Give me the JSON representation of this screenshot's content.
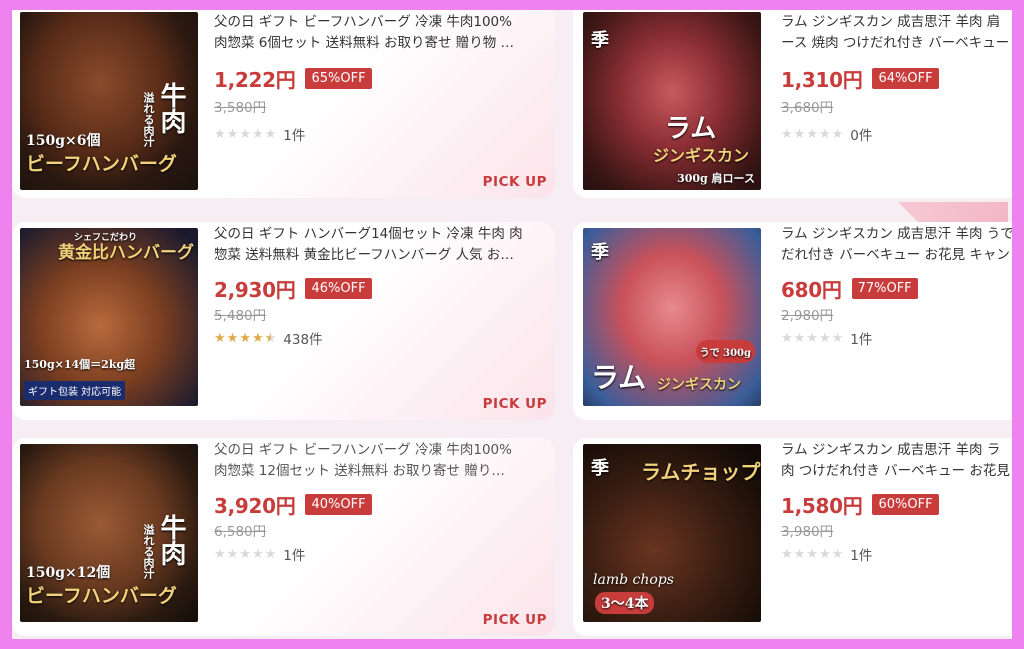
{
  "products": [
    {
      "id": "p1",
      "title_line1": "父の日 ギフト ビーフハンバーグ 冷凍 牛肉100%",
      "title_line2": "肉惣菜 6個セット 送料無料 お取り寄せ 贈り物 …",
      "price": "1,222円",
      "discount": "65%OFF",
      "original_price": "3,580円",
      "rating": 0,
      "review_count": "1件",
      "pickup": "PICK UP",
      "image_label_main": "ビーフハンバーグ",
      "image_label_count": "150g×6個",
      "image_label_side": "溢れる肉汁",
      "image_label_beef": "牛肉"
    },
    {
      "id": "p2",
      "title_line1": "ラム ジンギスカン 成吉思汗 羊肉 肩",
      "title_line2": "ース 焼肉 つけだれ付き バーベキュー",
      "price": "1,310円",
      "discount": "64%OFF",
      "original_price": "3,680円",
      "rating": 0,
      "review_count": "0件",
      "image_label_main": "ラム",
      "image_label_sub": "ジンギスカン",
      "image_label_weight": "300g 肩ロース",
      "image_label_season": "季"
    },
    {
      "id": "p3",
      "title_line1": "父の日 ギフト ハンバーグ14個セット 冷凍 牛肉 肉",
      "title_line2": "惣菜 送料無料 黄金比ビーフハンバーグ 人気 お…",
      "price": "2,930円",
      "discount": "46%OFF",
      "original_price": "5,480円",
      "rating": 4.5,
      "review_count": "438件",
      "pickup": "PICK UP",
      "image_label_main": "黄金比ハンバーグ",
      "image_label_top": "シェフこだわり",
      "image_label_count": "150g×14個＝2kg超",
      "image_label_gift": "ギフト包装 対応可能"
    },
    {
      "id": "p4",
      "title_line1": "ラム ジンギスカン 成吉思汗 羊肉 うで",
      "title_line2": "だれ付き バーベキュー お花見 キャン",
      "price": "680円",
      "discount": "77%OFF",
      "original_price": "2,980円",
      "rating": 0,
      "review_count": "1件",
      "image_label_main": "ラム",
      "image_label_sub": "ジンギスカン",
      "image_label_weight": "うで 300g",
      "image_label_season": "季"
    },
    {
      "id": "p5",
      "title_line1": "父の日 ギフト ビーフハンバーグ 冷凍 牛肉100%",
      "title_line2": "肉惣菜 12個セット 送料無料 お取り寄せ 贈り…",
      "price": "3,920円",
      "discount": "40%OFF",
      "original_price": "6,580円",
      "rating": 0,
      "review_count": "1件",
      "pickup": "PICK UP",
      "image_label_main": "ビーフハンバーグ",
      "image_label_count": "150g×12個",
      "image_label_side": "溢れる肉汁",
      "image_label_beef": "牛肉"
    },
    {
      "id": "p6",
      "title_line1": "ラム ジンギスカン 成吉思汗 羊肉 ラ",
      "title_line2": "肉 つけだれ付き バーベキュー お花見",
      "price": "1,580円",
      "discount": "60%OFF",
      "original_price": "3,980円",
      "rating": 0,
      "review_count": "1件",
      "image_label_main": "ラムチョップ",
      "image_label_sub": "lamb chops",
      "image_label_count": "3～4本",
      "image_label_season": "季"
    }
  ],
  "colors": {
    "accent": "#c83c3c",
    "star_on": "#e0a94a",
    "star_off": "#d9d9d9",
    "frame_border": "#ee82ee"
  }
}
